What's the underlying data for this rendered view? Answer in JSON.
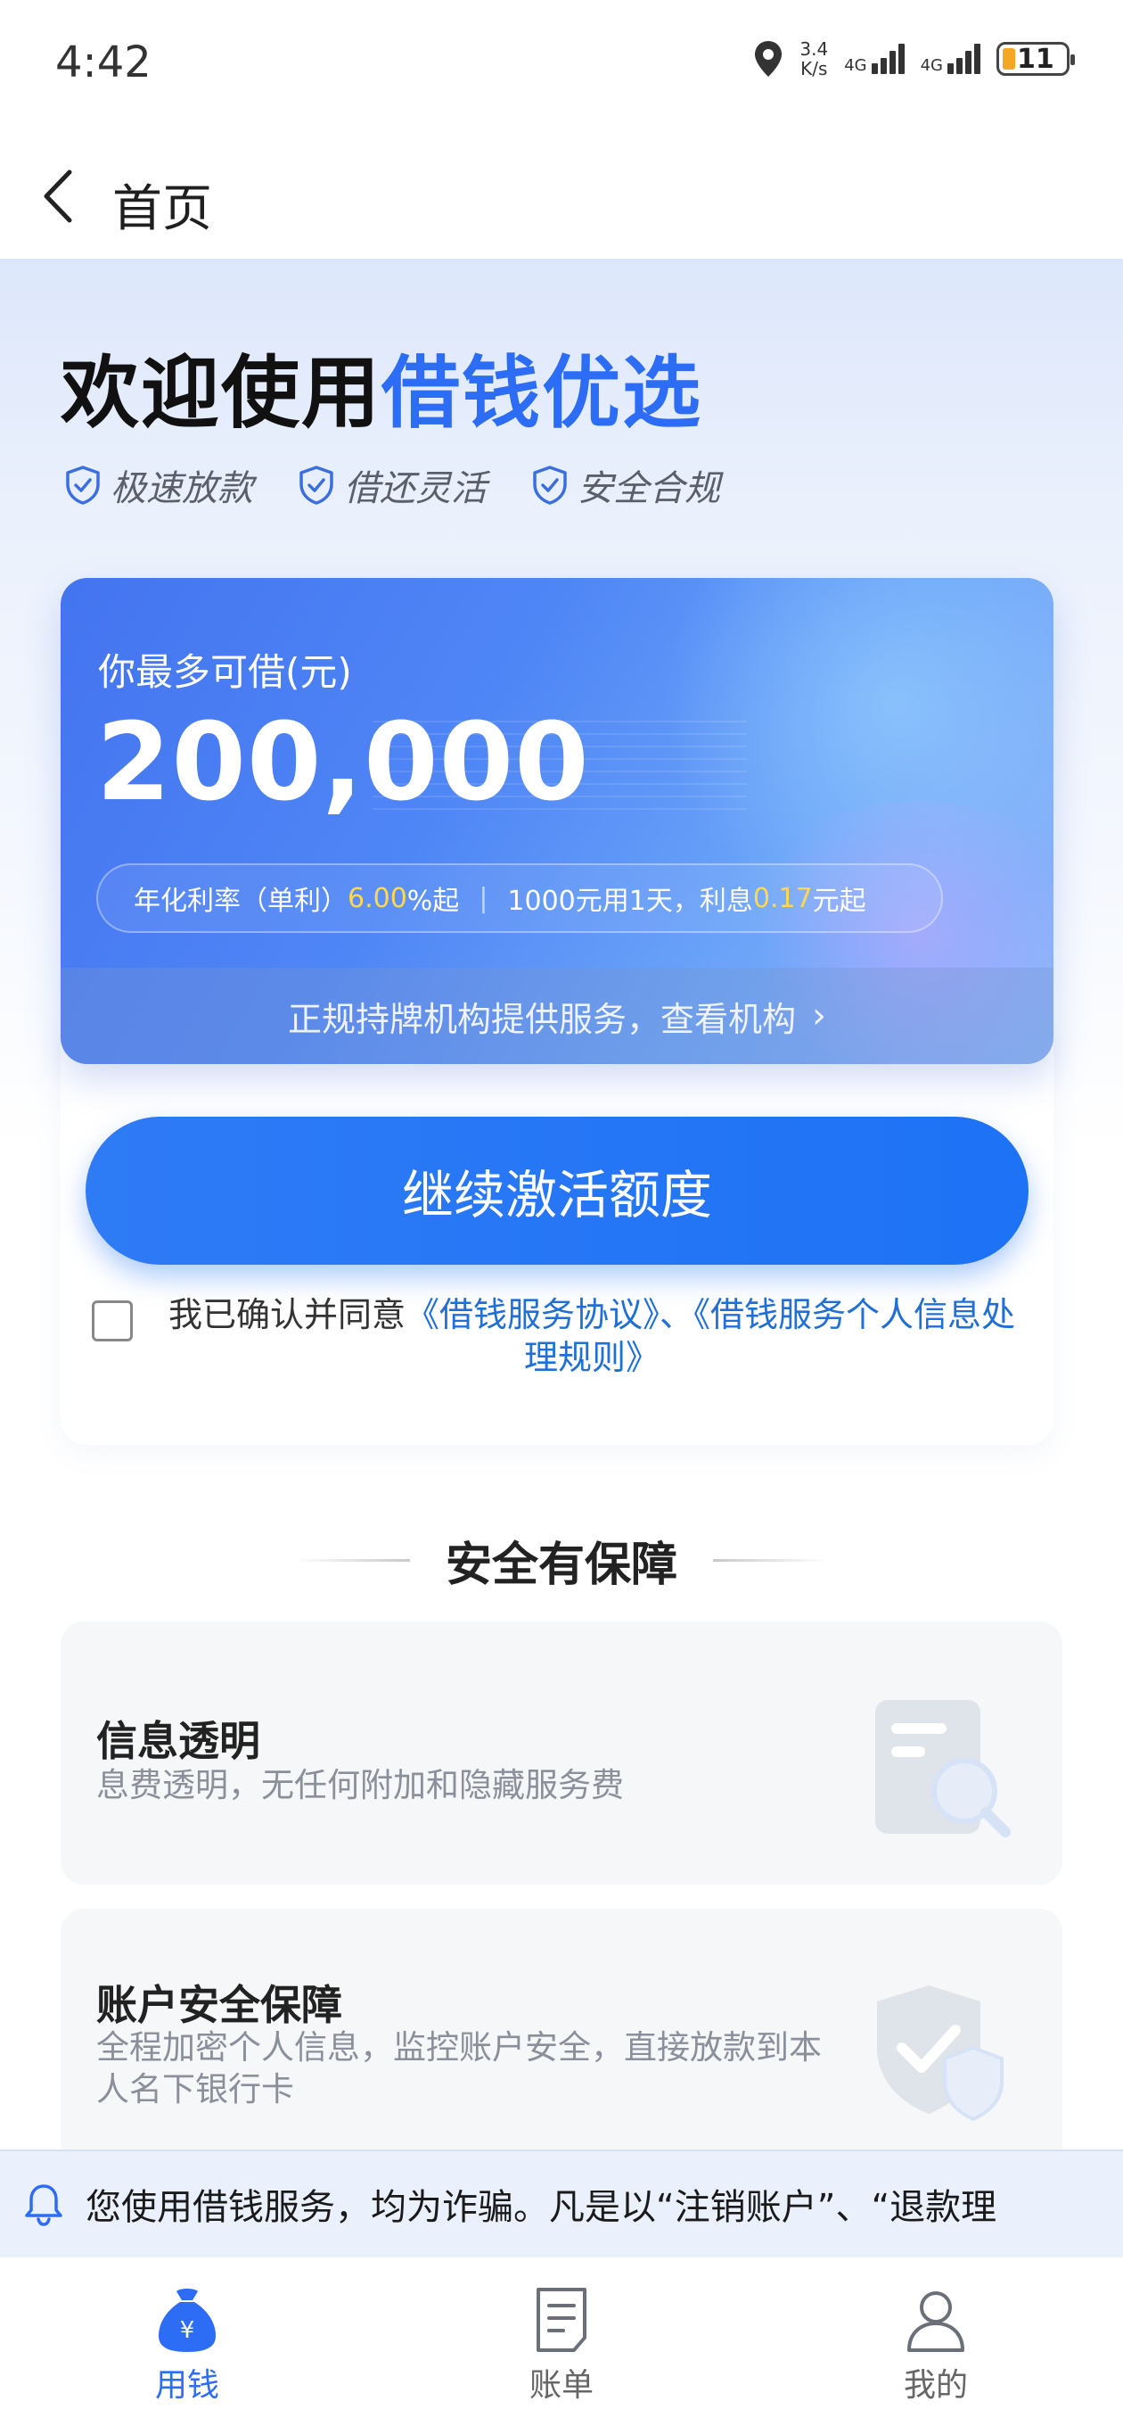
{
  "status_bar": {
    "time": "4:42",
    "speed_value": "3.4",
    "speed_unit": "K/s",
    "network1": "4G",
    "network2": "4G",
    "battery": "11"
  },
  "header": {
    "title": "首页"
  },
  "welcome": {
    "prefix": "欢迎使用",
    "brand": "借钱优选"
  },
  "features": [
    "极速放款",
    "借还灵活",
    "安全合规"
  ],
  "credit_card": {
    "label": "你最多可借(元)",
    "amount": "200,000",
    "rate_prefix": "年化利率（单利）",
    "rate_value": "6.00",
    "rate_suffix": "%起",
    "interest_prefix": "1000元用1天，利息",
    "interest_value": "0.17",
    "interest_suffix": "元起",
    "footer_text": "正规持牌机构提供服务，查看机构"
  },
  "action": {
    "button_label": "继续激活额度",
    "agree_prefix": "我已确认并同意",
    "agree_link1": "《借钱服务协议》",
    "agree_sep": "、",
    "agree_link2": "《借钱服务个人信息处理规则》"
  },
  "security": {
    "title": "安全有保障",
    "items": [
      {
        "title": "信息透明",
        "desc": "息费透明，无任何附加和隐藏服务费",
        "icon": "document-search-icon"
      },
      {
        "title": "账户安全保障",
        "desc": "全程加密个人信息，监控账户安全，直接放款到本人名下银行卡",
        "icon": "shield-check-icon"
      }
    ]
  },
  "notice": {
    "text": "您使用借钱服务，均为诈骗。凡是以“注销账户”、“退款理"
  },
  "tabs": [
    {
      "label": "用钱",
      "icon": "money-bag-icon",
      "active": true
    },
    {
      "label": "账单",
      "icon": "bill-icon",
      "active": false
    },
    {
      "label": "我的",
      "icon": "user-icon",
      "active": false
    }
  ],
  "colors": {
    "brand": "#2d6cf5",
    "highlight": "#ffd84d",
    "link": "#1f6fd6"
  }
}
